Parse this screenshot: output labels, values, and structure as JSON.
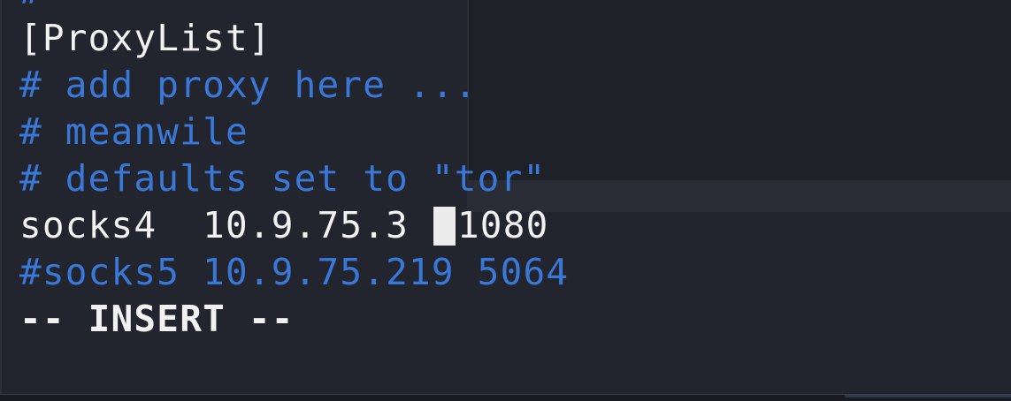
{
  "editor": {
    "lines": [
      "#",
      "[ProxyList]",
      "# add proxy here ...",
      "# meanwile",
      "# defaults set to \"tor\"",
      "socks4  10.9.75.3 ",
      "#socks5 10.9.75.219 5064"
    ],
    "cursor_line_after": "1080",
    "mode_indicator": "-- INSERT --"
  },
  "colors": {
    "background": "#23252e",
    "comment": "#3a78d8",
    "text": "#f2f2f2",
    "cursor": "#ececec"
  }
}
